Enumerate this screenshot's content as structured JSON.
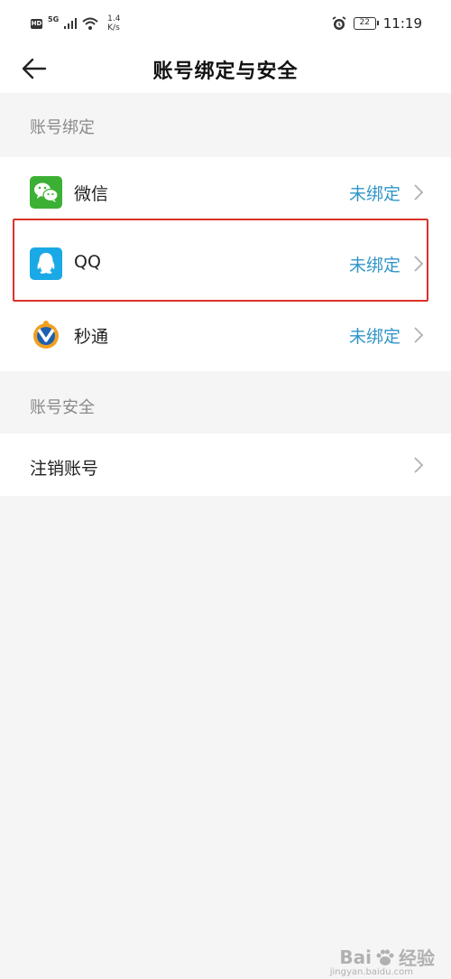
{
  "status_bar": {
    "hd": "HD",
    "network": "5G",
    "speed_value": "1.4",
    "speed_unit": "K/s",
    "battery": "22",
    "time": "11:19"
  },
  "header": {
    "title": "账号绑定与安全"
  },
  "binding_section": {
    "title": "账号绑定",
    "items": [
      {
        "label": "微信",
        "status": "未绑定",
        "icon": "wechat-icon"
      },
      {
        "label": "QQ",
        "status": "未绑定",
        "icon": "qq-icon"
      },
      {
        "label": "秒通",
        "status": "未绑定",
        "icon": "miaotong-icon"
      }
    ]
  },
  "security_section": {
    "title": "账号安全",
    "items": [
      {
        "label": "注销账号",
        "icon": "chevron-right-icon"
      }
    ]
  },
  "colors": {
    "accent": "#2f95c7",
    "highlight": "#d9332b",
    "wechat": "#3cb034",
    "qq": "#1aa9e6"
  },
  "watermark": {
    "brand": "Bai",
    "suffix": "经验",
    "sub": "jingyan.baidu.com"
  }
}
